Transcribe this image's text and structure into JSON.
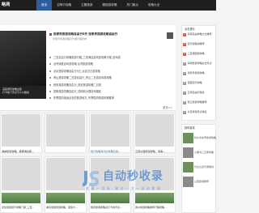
{
  "site": {
    "logo_text": "略网"
  },
  "nav": {
    "items": [
      {
        "label": "首页",
        "active": true
      },
      {
        "label": "自驾行攻略"
      },
      {
        "label": "主题旅游"
      },
      {
        "label": "跟团游攻略"
      },
      {
        "label": "热门景点"
      },
      {
        "label": "攻略大全"
      }
    ]
  },
  "slider": {
    "caption_lines": [
      "深度游玩攻略全集",
      "打卡热门景点与小众路线"
    ]
  },
  "headline": {
    "title": "张家界旅游攻略自由行5天 张家界旅游攻略自由行",
    "subtitle": "张家界旅游攻略自驾游行程安排"
  },
  "news": [
    "三亚自由行攻略旅游行程_三亚海边自驾游攻略行程_自驾游",
    "台湾深度自驾游攻略 台湾旅游攻略",
    "北京旅游攻略自由行5日_北京五日游攻略",
    "黄山旅游攻略二日游自由行_黄山二日游自驾游攻略",
    "西安旅游攻略自由行_西安旅游攻略二日游",
    "昆明旅游攻略自由行_昆明到大理自驾路线",
    "冬季国内最适合去的旅游地方_冬季国内旅游攻略推荐"
  ],
  "section": {
    "more_label": "更多>>"
  },
  "cards_top": [
    {
      "title": "海岸旅游攻略、娜娜海拉那..."
    },
    {
      "title": ""
    },
    {
      "title": "旅行攻略海平的攻略及旅..."
    },
    {
      "title": "云南大理旅游攻略、洱海..."
    }
  ],
  "cards_bottom": [
    {
      "title": "文化旅游旅行攻略门票_三亚..."
    },
    {
      "title": "湖北恩施旅游攻略、恩施大..."
    },
    {
      "title": "重庆旅游攻略必打卡的景点..."
    },
    {
      "title": "贵州旅游攻略推荐行程攻略..."
    }
  ],
  "sidebar": {
    "hot_title": "点击排行",
    "hot_items": [
      "海南自由攻略大全推荐",
      "自驾游路线推荐",
      "三亚跟团游攻略",
      "海南旅游攻略必去景点",
      "张家界旅游攻略",
      "西藏自驾攻略",
      "云南自由行路线",
      "丽江旅游攻略推荐",
      "北京旅游景点排名"
    ],
    "pic_title": "猜你喜欢",
    "pic_items": [
      "哈尔滨冰雪旅游攻略",
      "九寨沟三日游攻略",
      "长白山自驾游路线",
      "山西旅游推荐"
    ]
  },
  "watermark": {
    "main": "自动秒收录",
    "sub": "收 录 一 目 标 · 来 访 一 次 一 自 动 收 录"
  },
  "colors": {
    "topbar": "#1f1f1f",
    "nav_active": "#2d5f9e",
    "hot_num": "#e05a2b",
    "watermark": "#5b8fd0"
  }
}
